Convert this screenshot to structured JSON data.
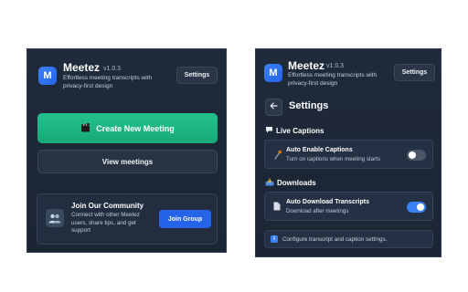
{
  "colors": {
    "panel_bg": "#1f2a3b",
    "primary_green": "#1fb985",
    "accent_blue": "#2563eb",
    "toggle_on": "#3b82f6",
    "toggle_off": "#4b5568"
  },
  "home": {
    "logo_letter": "M",
    "app_name": "Meetez",
    "version": "v1.0.3",
    "tagline": "Effortless meeting transcripts with privacy-first design",
    "settings_label": "Settings",
    "create_meeting_label": "Create New Meeting",
    "create_meeting_icon": "clapperboard-icon",
    "view_meetings_label": "View meetings",
    "community": {
      "icon": "users-icon",
      "title": "Join Our Community",
      "description": "Connect with other Meetez users, share tips, and get support",
      "button_label": "Join Group"
    }
  },
  "settings_view": {
    "logo_letter": "M",
    "app_name": "Meetez",
    "version": "v1.0.3",
    "tagline": "Effortless meeting transcripts with privacy-first design",
    "settings_label": "Settings",
    "back_icon": "arrow-left-icon",
    "heading": "Settings",
    "sections": [
      {
        "title": "Live Captions",
        "icon": "speech-bubble-icon",
        "setting": {
          "label": "Auto Enable Captions",
          "description": "Turn on captions when meeting starts",
          "icon": "microphone-icon",
          "enabled": false
        }
      },
      {
        "title": "Downloads",
        "icon": "inbox-tray-icon",
        "setting": {
          "label": "Auto Download Transcripts",
          "description": "Download after meetings",
          "icon": "document-icon",
          "enabled": true
        }
      }
    ],
    "info_icon": "info-icon",
    "info_text": "Configure transcript and caption settings."
  }
}
